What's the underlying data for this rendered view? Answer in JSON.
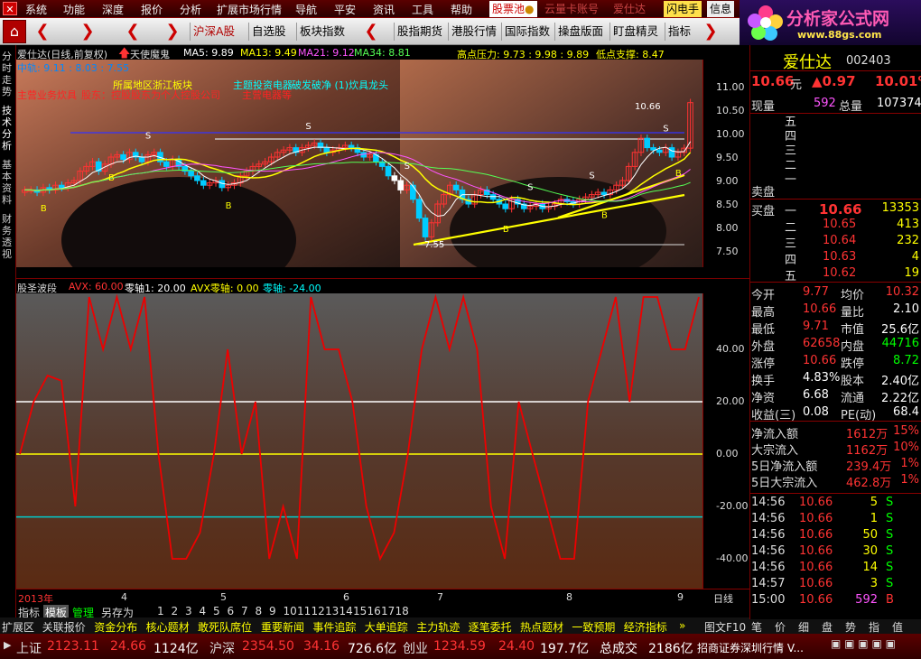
{
  "menu": {
    "items": [
      "系统",
      "功能",
      "深度",
      "报价",
      "分析",
      "扩展市场行情",
      "导航",
      "平安",
      "资讯",
      "工具",
      "帮助"
    ],
    "pool": "股票池",
    "tag1": "云量卡账号",
    "tag2": "爱仕达",
    "flash": "闪电手",
    "info": "信息"
  },
  "logo": {
    "title": "分析家公式网",
    "url": "www.88gs.com"
  },
  "toolbar": {
    "buttons": [
      "沪深A股",
      "自选股",
      "板块指数",
      "股指期货",
      "港股行情",
      "国际指数",
      "操盘版面",
      "盯盘精灵",
      "指标"
    ]
  },
  "sidetabs": [
    "分时走势",
    "技术分析",
    "基本资料",
    "财务透视"
  ],
  "chart": {
    "header_title": "爱仕达(日线,前复权)",
    "header_arrow_label": "天使魔鬼",
    "ma": [
      {
        "label": "MA5: 9.89",
        "color": "#ffffff"
      },
      {
        "label": "MA13: 9.49",
        "color": "#ffff00"
      },
      {
        "label": "MA21: 9.12",
        "color": "#ff55ff"
      },
      {
        "label": "MA34: 8.81",
        "color": "#55ff55"
      }
    ],
    "resistance": "高点压力: 9.73 : 9.98 : 9.89",
    "support": "低点支撑: 8.47",
    "row2": "中轨: 9.11 : 8.03 : 7.55",
    "row3_a": "所属地区浙江板块",
    "row3_b": "主题投资电器",
    "row3_c": "破发破净 (1)炊具龙头",
    "row4_a": "主营业务炊具",
    "row4_b": "股东：控股股东为个人控股公司",
    "row4_c": "主营电器等",
    "price_ticks": [
      "11.00",
      "10.50",
      "10.00",
      "9.50",
      "9.00",
      "8.50",
      "8.00",
      "7.50"
    ],
    "high_label": "10.66",
    "low_label": "7.55",
    "signal_s": "S",
    "signal_b": "B"
  },
  "indicator": {
    "name": "股圣波段",
    "avx": "AVX: 60.00",
    "zero1": "零轴1: 20.00",
    "avxzero": "AVX零轴: 0.00",
    "zero": "零轴: -24.00",
    "ticks": [
      "40.00",
      "20.00",
      "0.00",
      "-20.00",
      "-40.00"
    ]
  },
  "chart_data": {
    "type": "line",
    "x_axis_labels": [
      "2013年",
      "4",
      "5",
      "6",
      "7",
      "8",
      "9"
    ],
    "period": "日线",
    "series": [
      {
        "name": "股圣波段",
        "values": [
          0,
          20,
          30,
          28,
          -20,
          60,
          40,
          60,
          40,
          60,
          0,
          -40,
          -40,
          -30,
          0,
          40,
          0,
          20,
          -40,
          -20,
          -40,
          60,
          40,
          40,
          20,
          -20,
          -40,
          -30,
          0,
          40,
          60,
          40,
          60,
          40,
          -20,
          -40,
          20,
          0,
          -20,
          -40,
          -40,
          20,
          40,
          60,
          20,
          60,
          60,
          40,
          40,
          60
        ]
      }
    ],
    "levels": [
      20,
      0,
      -24
    ],
    "ylim": [
      -50,
      60
    ]
  },
  "bottom": {
    "tabs1": [
      "指标",
      "模板",
      "管理",
      "另存为",
      "1",
      "2",
      "3",
      "4",
      "5",
      "6",
      "7",
      "8",
      "9",
      "10",
      "11",
      "12",
      "13",
      "14",
      "15",
      "16",
      "17",
      "18"
    ],
    "tabs2": [
      "扩展区",
      "关联报价",
      "资金分布",
      "核心题材",
      "敢死队席位",
      "重要新闻",
      "事件追踪",
      "大单追踪",
      "主力轨迹",
      "逐笔委托",
      "热点题材",
      "一致预期",
      "经济指标"
    ],
    "corner": "图文F10",
    "rtabs": [
      "笔",
      "价",
      "细",
      "盘",
      "势",
      "指",
      "值"
    ]
  },
  "stock": {
    "name": "爱仕达",
    "code": "002403",
    "price": "10.66",
    "unit": "元",
    "change": "▲0.97",
    "pct": "10.01%",
    "xianliang": "现量",
    "xl": "592",
    "zongliang": "总量",
    "zl": "107374",
    "sells": [
      "五",
      "四",
      "三",
      "二",
      "一"
    ],
    "sell_label": "卖盘",
    "buy_label": "买盘",
    "buys": [
      [
        "一",
        "10.66",
        "13353"
      ],
      [
        "二",
        "10.65",
        "413"
      ],
      [
        "三",
        "10.64",
        "232"
      ],
      [
        "四",
        "10.63",
        "4"
      ],
      [
        "五",
        "10.62",
        "19"
      ]
    ],
    "stats": [
      [
        "今开",
        "9.77",
        "均价",
        "10.32"
      ],
      [
        "最高",
        "10.66",
        "量比",
        "2.10"
      ],
      [
        "最低",
        "9.71",
        "市值",
        "25.6亿"
      ],
      [
        "外盘",
        "62658",
        "内盘",
        "44716"
      ],
      [
        "涨停",
        "10.66",
        "跌停",
        "8.72"
      ],
      [
        "换手",
        "4.83%",
        "股本",
        "2.40亿"
      ],
      [
        "净资",
        "6.68",
        "流通",
        "2.22亿"
      ],
      [
        "收益(三)",
        "0.08",
        "PE(动)",
        "68.4"
      ]
    ],
    "flows": [
      [
        "净流入额",
        "1612万",
        "15%"
      ],
      [
        "大宗流入",
        "1162万",
        "10%"
      ],
      [
        "5日净流入额",
        "239.4万",
        "1%"
      ],
      [
        "5日大宗流入",
        "462.8万",
        "1%"
      ]
    ],
    "ticks": [
      [
        "14:56",
        "10.66",
        "5",
        "S"
      ],
      [
        "14:56",
        "10.66",
        "1",
        "S"
      ],
      [
        "14:56",
        "10.66",
        "50",
        "S"
      ],
      [
        "14:56",
        "10.66",
        "30",
        "S"
      ],
      [
        "14:56",
        "10.66",
        "14",
        "S"
      ],
      [
        "14:57",
        "10.66",
        "3",
        "S"
      ],
      [
        "15:00",
        "10.66",
        "592",
        "B"
      ]
    ]
  },
  "indices": {
    "sh_label": "上证",
    "sh": "2123.11",
    "sh_chg": "24.66",
    "sh_amt": "1124亿",
    "hs_label": "沪深",
    "hs": "2354.50",
    "hs_chg": "34.16",
    "hs_amt": "726.6亿",
    "cy_label": "创业",
    "cy": "1234.59",
    "cy_chg": "24.40",
    "cy_amt": "197.7亿",
    "total_label": "总成交",
    "total": "2186亿",
    "ticker": "招商证券深圳行情 V..."
  }
}
